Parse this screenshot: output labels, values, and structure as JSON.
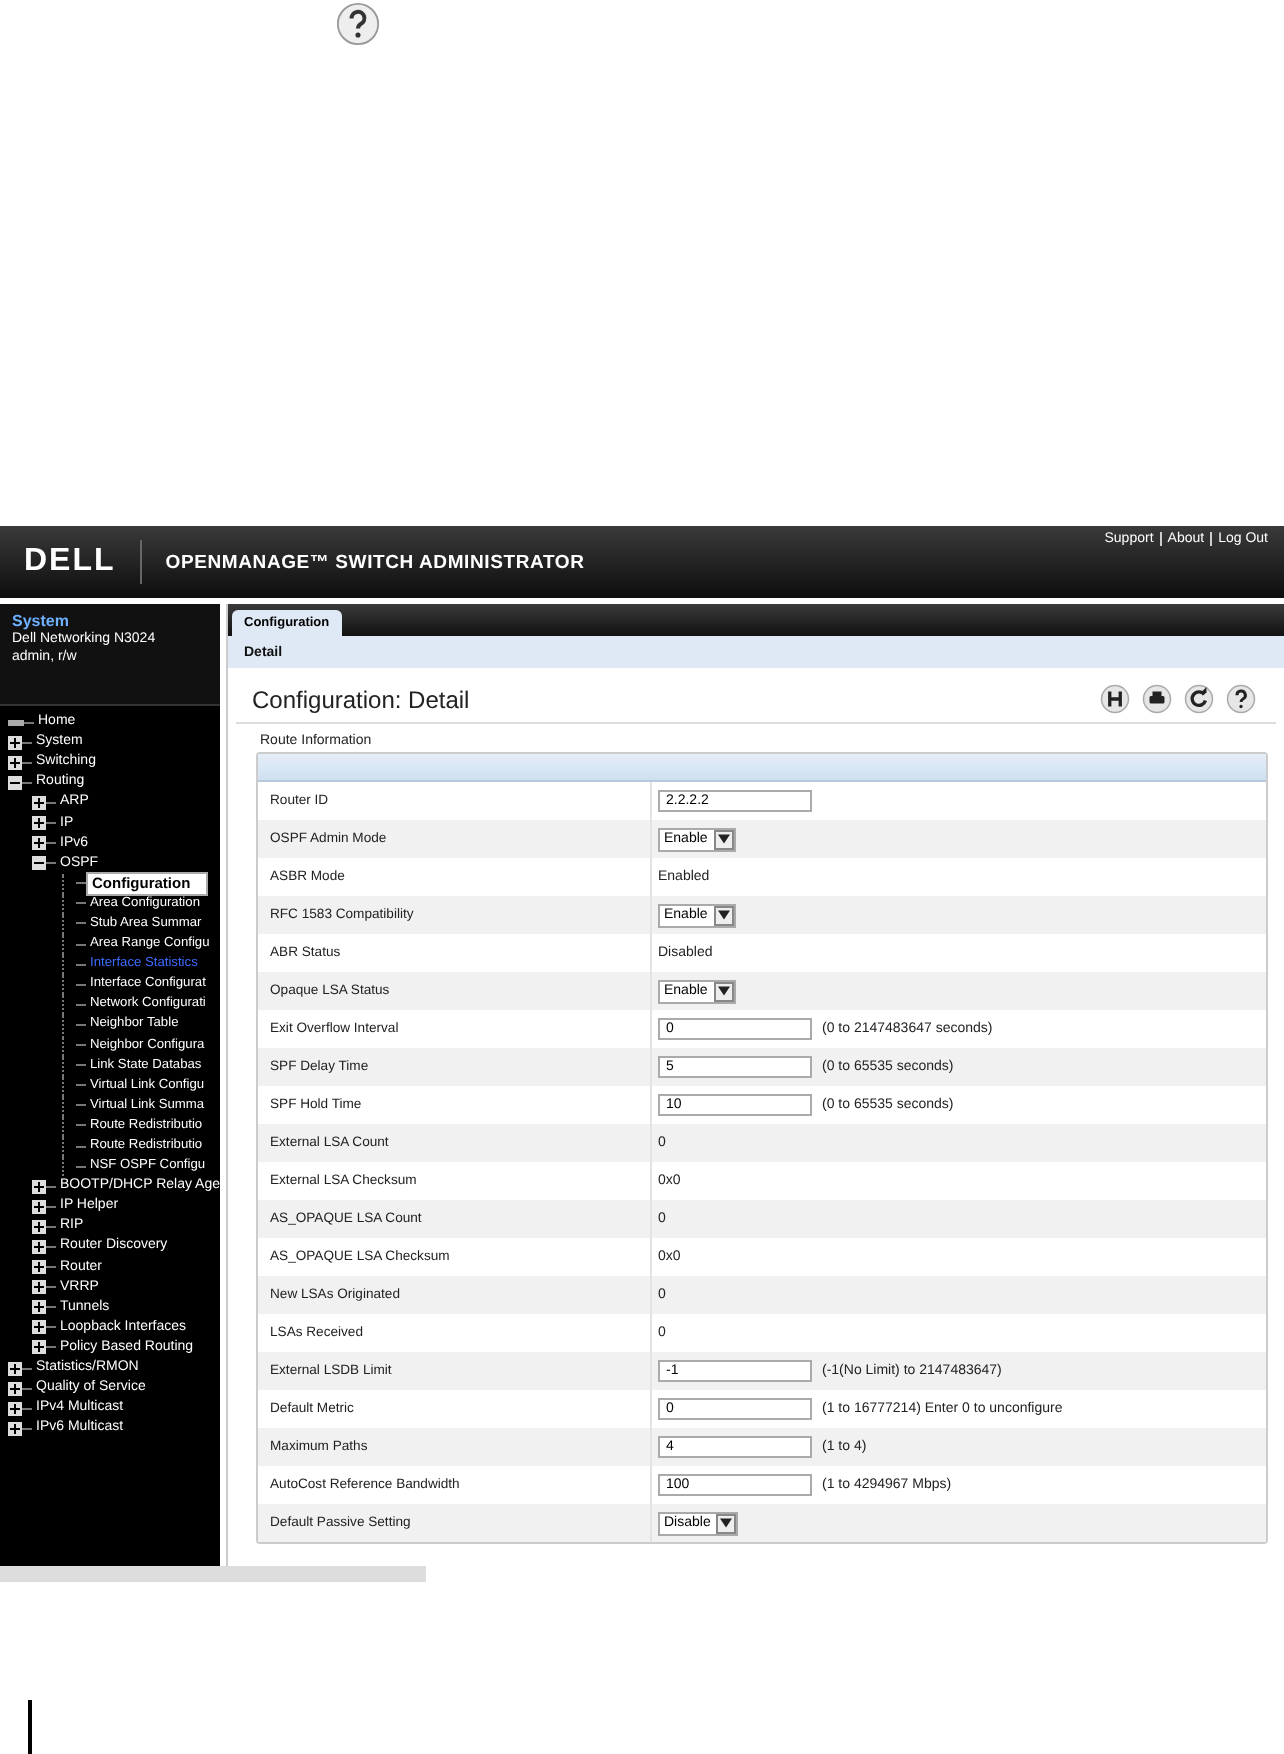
{
  "header": {
    "logo": "DELL",
    "product": "OPENMANAGE™ SWITCH ADMINISTRATOR",
    "links": [
      "Support",
      "About",
      "Log Out"
    ]
  },
  "system": {
    "title": "System",
    "device": "Dell Networking N3024",
    "user": "admin, r/w"
  },
  "tree": [
    {
      "label": "Home",
      "kind": "home",
      "selected": false
    },
    {
      "label": "System",
      "kind": "node",
      "expanded": false,
      "selected": false
    },
    {
      "label": "Switching",
      "kind": "node",
      "expanded": false,
      "selected": false
    },
    {
      "label": "Routing",
      "kind": "node",
      "expanded": true,
      "selected": false,
      "children": [
        {
          "label": "ARP",
          "kind": "node",
          "expanded": false,
          "selected": false
        },
        {
          "label": "IP",
          "kind": "node",
          "expanded": false,
          "selected": false
        },
        {
          "label": "IPv6",
          "kind": "node",
          "expanded": false,
          "selected": false
        },
        {
          "label": "OSPF",
          "kind": "node",
          "expanded": true,
          "selected": false,
          "children": [
            {
              "label": "Configuration",
              "kind": "leaf",
              "selected": true
            },
            {
              "label": "Area Configuration",
              "kind": "leaf",
              "selected": false
            },
            {
              "label": "Stub Area Summar",
              "kind": "leaf",
              "selected": false
            },
            {
              "label": "Area Range Configu",
              "kind": "leaf",
              "selected": false
            },
            {
              "label": "Interface Statistics",
              "kind": "leaf",
              "selected": false,
              "visited": true
            },
            {
              "label": "Interface Configurat",
              "kind": "leaf",
              "selected": false
            },
            {
              "label": "Network Configurati",
              "kind": "leaf",
              "selected": false
            },
            {
              "label": "Neighbor Table",
              "kind": "leaf",
              "selected": false
            },
            {
              "label": "Neighbor Configura",
              "kind": "leaf",
              "selected": false
            },
            {
              "label": "Link State Databas",
              "kind": "leaf",
              "selected": false
            },
            {
              "label": "Virtual Link Configu",
              "kind": "leaf",
              "selected": false
            },
            {
              "label": "Virtual Link Summa",
              "kind": "leaf",
              "selected": false
            },
            {
              "label": "Route Redistributio",
              "kind": "leaf",
              "selected": false
            },
            {
              "label": "Route Redistributio",
              "kind": "leaf",
              "selected": false
            },
            {
              "label": "NSF OSPF Configu",
              "kind": "leaf",
              "selected": false
            }
          ]
        },
        {
          "label": "BOOTP/DHCP Relay Age",
          "kind": "node",
          "expanded": false,
          "selected": false
        },
        {
          "label": "IP Helper",
          "kind": "node",
          "expanded": false,
          "selected": false
        },
        {
          "label": "RIP",
          "kind": "node",
          "expanded": false,
          "selected": false
        },
        {
          "label": "Router Discovery",
          "kind": "node",
          "expanded": false,
          "selected": false
        },
        {
          "label": "Router",
          "kind": "node",
          "expanded": false,
          "selected": false
        },
        {
          "label": "VRRP",
          "kind": "node",
          "expanded": false,
          "selected": false
        },
        {
          "label": "Tunnels",
          "kind": "node",
          "expanded": false,
          "selected": false
        },
        {
          "label": "Loopback Interfaces",
          "kind": "node",
          "expanded": false,
          "selected": false
        },
        {
          "label": "Policy Based Routing",
          "kind": "node",
          "expanded": false,
          "selected": false
        }
      ]
    },
    {
      "label": "Statistics/RMON",
      "kind": "node",
      "expanded": false,
      "selected": false
    },
    {
      "label": "Quality of Service",
      "kind": "node",
      "expanded": false,
      "selected": false
    },
    {
      "label": "IPv4 Multicast",
      "kind": "node",
      "expanded": false,
      "selected": false
    },
    {
      "label": "IPv6 Multicast",
      "kind": "node",
      "expanded": false,
      "selected": false
    }
  ],
  "tabs": [
    {
      "label": "Configuration",
      "selected": true
    }
  ],
  "subtabs": [
    {
      "label": "Detail",
      "selected": true
    }
  ],
  "page_title": "Configuration: Detail",
  "section": "Route Information",
  "rows": [
    {
      "label": "Router ID",
      "kind": "input",
      "value": "2.2.2.2"
    },
    {
      "label": "OSPF Admin Mode",
      "kind": "select",
      "value": "Enable"
    },
    {
      "label": "ASBR Mode",
      "kind": "text",
      "value": "Enabled"
    },
    {
      "label": "RFC 1583 Compatibility",
      "kind": "select",
      "value": "Enable"
    },
    {
      "label": "ABR Status",
      "kind": "text",
      "value": "Disabled"
    },
    {
      "label": "Opaque LSA Status",
      "kind": "select",
      "value": "Enable"
    },
    {
      "label": "Exit Overflow Interval",
      "kind": "input",
      "value": "0",
      "hint": "(0 to 2147483647 seconds)"
    },
    {
      "label": "SPF Delay Time",
      "kind": "input",
      "value": "5",
      "hint": "(0 to 65535 seconds)"
    },
    {
      "label": "SPF Hold Time",
      "kind": "input",
      "value": "10",
      "hint": "(0 to 65535 seconds)"
    },
    {
      "label": "External LSA Count",
      "kind": "text",
      "value": "0"
    },
    {
      "label": "External LSA Checksum",
      "kind": "text",
      "value": "0x0"
    },
    {
      "label": "AS_OPAQUE LSA Count",
      "kind": "text",
      "value": "0"
    },
    {
      "label": "AS_OPAQUE LSA Checksum",
      "kind": "text",
      "value": "0x0"
    },
    {
      "label": "New LSAs Originated",
      "kind": "text",
      "value": "0"
    },
    {
      "label": "LSAs Received",
      "kind": "text",
      "value": "0"
    },
    {
      "label": "External LSDB Limit",
      "kind": "input",
      "value": "-1",
      "hint": "(-1(No Limit) to 2147483647)"
    },
    {
      "label": "Default Metric",
      "kind": "input",
      "value": "0",
      "hint": "(1 to 16777214) Enter 0 to unconfigure"
    },
    {
      "label": "Maximum Paths",
      "kind": "input",
      "value": "4",
      "hint": "(1 to 4)"
    },
    {
      "label": "AutoCost Reference Bandwidth",
      "kind": "input",
      "value": "100",
      "hint": "(1 to 4294967 Mbps)"
    },
    {
      "label": "Default Passive Setting",
      "kind": "select",
      "value": "Disable"
    }
  ]
}
